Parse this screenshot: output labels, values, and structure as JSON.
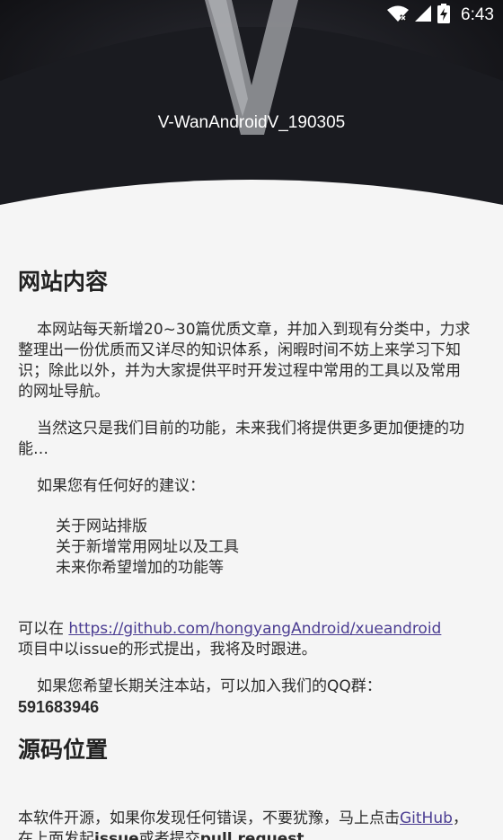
{
  "status_bar": {
    "time": "6:43",
    "icons": [
      "wifi-off-icon",
      "cell-signal-icon",
      "battery-charging-icon"
    ]
  },
  "header": {
    "version": "V-WanAndroidV_190305"
  },
  "section1": {
    "title": "网站内容",
    "para1": "本网站每天新增20~30篇优质文章，并加入到现有分类中，力求整理出一份优质而又详尽的知识体系，闲暇时间不妨上来学习下知识；除此以外，并为大家提供平时开发过程中常用的工具以及常用的网址导航。",
    "para2": "当然这只是我们目前的功能，未来我们将提供更多更加便捷的功能…",
    "para3": "如果您有任何好的建议：",
    "suggestions": [
      "关于网站排版",
      "关于新增常用网址以及工具",
      "未来你希望增加的功能等"
    ],
    "para4_prefix": "可以在 ",
    "para4_link": "https://github.com/hongyangAndroid/xueandroid",
    "para4_suffix": "项目中以issue的形式提出，我将及时跟进。",
    "para5": "如果您希望长期关注本站，可以加入我们的QQ群：",
    "qq": "591683946"
  },
  "section2": {
    "title": "源码位置",
    "para_prefix": "本软件开源，如果你发现任何错误，不要犹豫，马上点击",
    "link": "GitHub",
    "para_mid1": "，在上面发起",
    "bold1": "issue",
    "para_mid2": "或者提交",
    "bold2": "pull request",
    "para_end": "。"
  }
}
